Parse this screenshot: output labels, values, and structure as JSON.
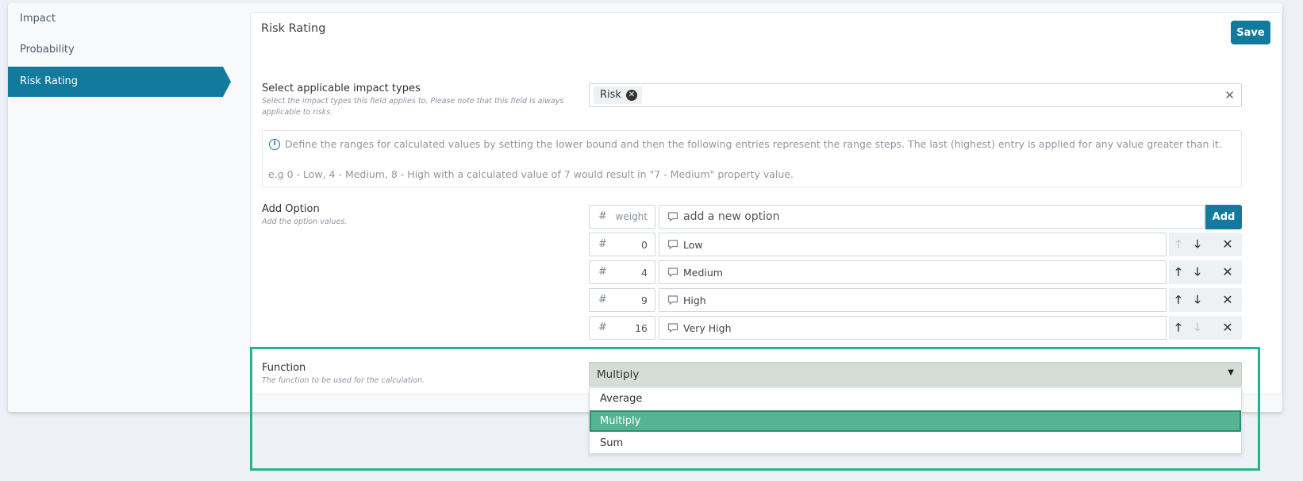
{
  "sidebar": {
    "items": [
      {
        "label": "Impact"
      },
      {
        "label": "Probability"
      },
      {
        "label": "Risk Rating",
        "active": true
      }
    ]
  },
  "card": {
    "title": "Risk Rating",
    "save_label": "Save"
  },
  "impact_types": {
    "label": "Select applicable impact types",
    "help": "Select the impact types this field applies to. Please note that this field is always applicable to risks.",
    "selected_tags": [
      "Risk"
    ]
  },
  "info": {
    "line1": "Define the ranges for calculated values by setting the lower bound and then the following entries represent the range steps. The last (highest) entry is applied for any value greater than it.",
    "line2": "e.g 0 - Low, 4 - Medium, 8 - High with a calculated value of 7 would result in \"7 - Medium\" property value."
  },
  "add_option": {
    "label": "Add Option",
    "help": "Add the option values.",
    "weight_placeholder": "weight",
    "text_placeholder": "add a new option",
    "add_label": "Add",
    "options": [
      {
        "weight": "0",
        "text": "Low",
        "up_enabled": false,
        "down_enabled": true
      },
      {
        "weight": "4",
        "text": "Medium",
        "up_enabled": true,
        "down_enabled": true
      },
      {
        "weight": "9",
        "text": "High",
        "up_enabled": true,
        "down_enabled": true
      },
      {
        "weight": "16",
        "text": "Very High",
        "up_enabled": true,
        "down_enabled": false
      }
    ]
  },
  "function": {
    "label": "Function",
    "help": "The function to be used for the calculation.",
    "selected": "Multiply",
    "options": [
      "Average",
      "Multiply",
      "Sum"
    ]
  },
  "colors": {
    "accent": "#117a9d",
    "highlight": "#22b48f",
    "selected_option": "#56b394"
  }
}
